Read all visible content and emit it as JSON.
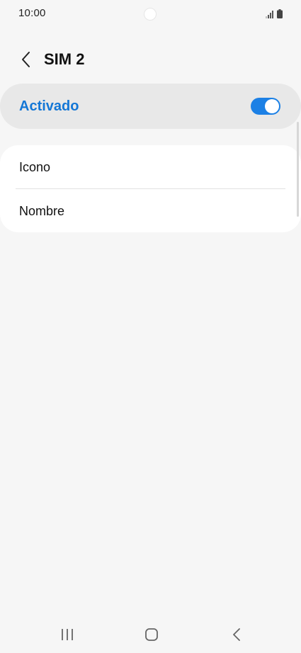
{
  "status_bar": {
    "time": "10:00",
    "icons": [
      "signal-icon",
      "battery-icon"
    ]
  },
  "header": {
    "back_icon": "chevron-left-icon",
    "title": "SIM 2"
  },
  "master_switch": {
    "label": "Activado",
    "state": "on",
    "accent_color": "#1c80e5",
    "label_color": "#1477d6"
  },
  "settings_list": {
    "items": [
      {
        "label": "Icono"
      },
      {
        "label": "Nombre"
      }
    ]
  },
  "nav_bar": {
    "buttons": [
      "recents-icon",
      "home-icon",
      "back-icon"
    ]
  }
}
